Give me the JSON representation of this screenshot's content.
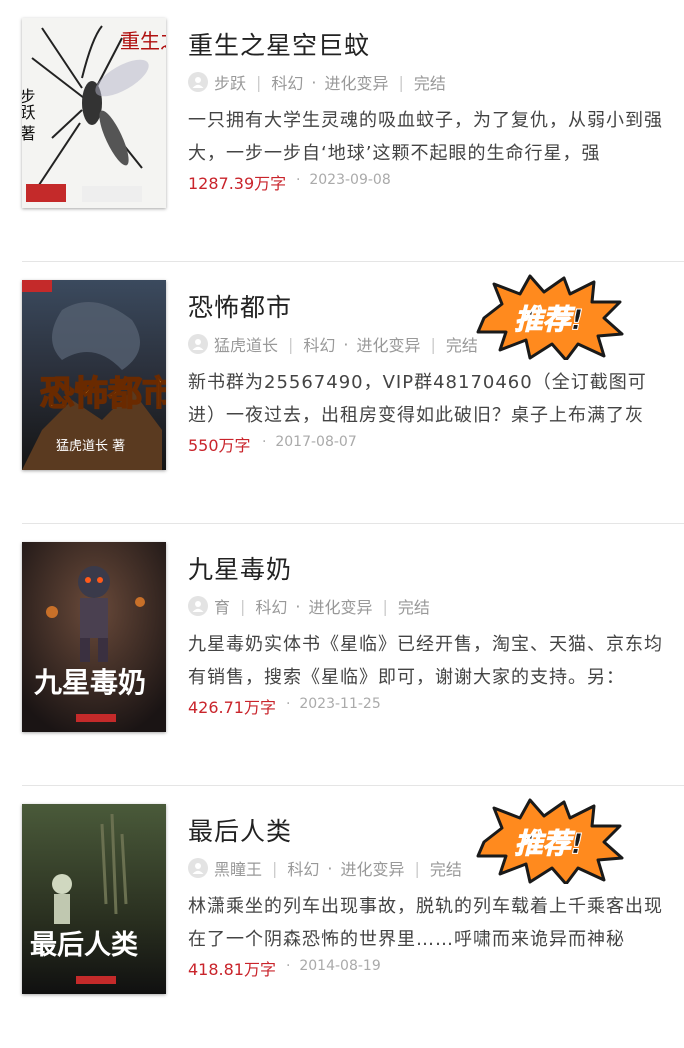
{
  "books": [
    {
      "title": "重生之星空巨蚊",
      "author": "步跃",
      "category": "科幻",
      "subcategory": "进化变异",
      "status": "完结",
      "description": "一只拥有大学生灵魂的吸血蚊子，为了复仇，从弱小到强大，一步一步自‘地球’这颗不起眼的生命行星，强",
      "word_count": "1287.39万字",
      "date": "2023-09-08",
      "cover_title": "重生之星空巨蚊",
      "cover_author": "步跃 著",
      "recommended": false
    },
    {
      "title": "恐怖都市",
      "author": "猛虎道长",
      "category": "科幻",
      "subcategory": "进化变异",
      "status": "完结",
      "description": "新书群为25567490，VIP群48170460（全订截图可进）一夜过去，出租房变得如此破旧？桌子上布满了灰",
      "word_count": "550万字",
      "date": "2017-08-07",
      "cover_title": "恐怖都市",
      "cover_author": "猛虎道长 著",
      "recommended": true
    },
    {
      "title": "九星毒奶",
      "author": "育",
      "category": "科幻",
      "subcategory": "进化变异",
      "status": "完结",
      "description": "九星毒奶实体书《星临》已经开售，淘宝、天猫、京东均有销售，搜索《星临》即可，谢谢大家的支持。另：",
      "word_count": "426.71万字",
      "date": "2023-11-25",
      "cover_title": "九星毒奶",
      "cover_author": "",
      "recommended": false
    },
    {
      "title": "最后人类",
      "author": "黑瞳王",
      "category": "科幻",
      "subcategory": "进化变异",
      "status": "完结",
      "description": "林潇乘坐的列车出现事故，脱轨的列车载着上千乘客出现在了一个阴森恐怖的世界里……呼啸而来诡异而神秘",
      "word_count": "418.81万字",
      "date": "2014-08-19",
      "cover_title": "最后人类",
      "cover_author": "",
      "recommended": true
    }
  ],
  "badge_text": "推荐!",
  "colors": {
    "word_count": "#c9242b",
    "badge_fill": "#ff8a1e",
    "badge_text": "#1a1a1a"
  },
  "icons": {
    "author_avatar": "user-icon",
    "badge": "starburst-badge"
  }
}
